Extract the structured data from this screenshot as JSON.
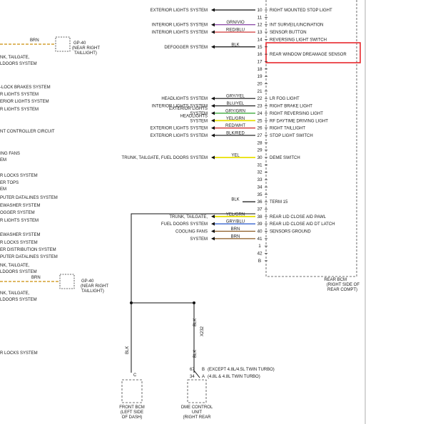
{
  "colors": {
    "highlight": "#e8262b",
    "wire_default": "#111111",
    "wire_orange": "#d4a030",
    "wire_yellow": "#e8e000",
    "wire_purple": "#7a2f9a",
    "wire_red": "#cc2222",
    "wire_blue": "#2255cc",
    "wire_green": "#2aa02a",
    "wire_brown": "#8a5a20"
  },
  "left_labels": [
    "NK, TAILGATE,",
    "LDOORS SYSTEM",
    "-LOCK BRAKES SYSTEM",
    "R LIGHTS SYSTEM",
    "ERIOR LIGHTS SYSTEM",
    "R LIGHTS SYSTEM",
    "NT CONTROLLER CIRCUIT",
    "ING FANS",
    "EM",
    "R LOCKS SYSTEM",
    "ER TOPS",
    "EM",
    "PUTER DATALINES SYSTEM",
    "EWASHER SYSTEM",
    "OGGER SYSTEM",
    "R LIGHTS SYSTEM",
    "EWASHER SYSTEM",
    "R LOCKS SYSTEM",
    "ER DISTRIBUTION SYSTEM",
    "PUTER DATALINES SYSTEM",
    "NK, TAILGATE,",
    "LDOORS SYSTEM",
    "NK, TAILGATE,",
    "LDOORS SYSTEM",
    "R LOCKS SYSTEM"
  ],
  "connectors": {
    "upper": {
      "wire": "BRN",
      "id": "GP-40",
      "loc1": "(NEAR RIGHT",
      "loc2": "TAILLIGHT)"
    },
    "lower": {
      "wire": "BRN",
      "id": "GP-40",
      "loc1": "(NEAR RIGHT",
      "loc2": "TAILLIGHT)"
    }
  },
  "pins": [
    {
      "num": "10",
      "system": [
        "EXTERIOR LIGHTS SYSTEM"
      ],
      "wire": "",
      "desc": "RIGHT MOUNTED STOP LIGHT"
    },
    {
      "num": "11",
      "system": [],
      "wire": "",
      "desc": ""
    },
    {
      "num": "12",
      "system": [
        "INTERIOR LIGHTS SYSTEM"
      ],
      "wire": "GRN/VIO",
      "desc": "INT SURVEIL/UNCINATION"
    },
    {
      "num": "13",
      "system": [
        "INTERIOR LIGHTS SYSTEM"
      ],
      "wire": "RED/BLU",
      "desc": "SENSOR BUTTON"
    },
    {
      "num": "14",
      "system": [],
      "wire": "",
      "desc": "REVERSING LIGHT SWITCH"
    },
    {
      "num": "15",
      "system": [
        "DEFOGGER SYSTEM"
      ],
      "wire": "BLK",
      "desc": ""
    },
    {
      "num": "16",
      "system": [],
      "wire": "",
      "desc": "REAR WINDOW DREAMAGE SENSOR"
    },
    {
      "num": "17",
      "system": [],
      "wire": "",
      "desc": ""
    },
    {
      "num": "18",
      "system": [],
      "wire": "",
      "desc": ""
    },
    {
      "num": "19",
      "system": [],
      "wire": "",
      "desc": ""
    },
    {
      "num": "20",
      "system": [],
      "wire": "",
      "desc": ""
    },
    {
      "num": "21",
      "system": [],
      "wire": "",
      "desc": ""
    },
    {
      "num": "22",
      "system": [
        "HEADLIGHTS SYSTEM"
      ],
      "wire": "GRY/YEL",
      "desc": "LR FOG LIGHT"
    },
    {
      "num": "23",
      "system": [
        "INTERIOR LIGHTS SYSTEM"
      ],
      "wire": "BLU/YEL",
      "desc": "RIGHT BRAKE LIGHT"
    },
    {
      "num": "24",
      "system": [
        "EXTERIOR LIGHTS",
        "SYSTEM"
      ],
      "wire": "GRY/GRN",
      "desc": "RIGHT REVERSING LIGHT"
    },
    {
      "num": "25",
      "system": [
        "HEADLIGHTS",
        "SYSTEM"
      ],
      "wire": "YEL/GRN",
      "desc": "RF DAYTIME DRIVING LIGHT"
    },
    {
      "num": "26",
      "system": [
        "EXTERIOR LIGHTS SYSTEM"
      ],
      "wire": "RED/WHT",
      "desc": "RIGHT TAILLIGHT"
    },
    {
      "num": "27",
      "system": [
        "EXTERIOR LIGHTS SYSTEM"
      ],
      "wire": "BLK/RED",
      "desc": "STOP LIGHT SWITCH"
    },
    {
      "num": "28",
      "system": [],
      "wire": "",
      "desc": ""
    },
    {
      "num": "29",
      "system": [],
      "wire": "",
      "desc": ""
    },
    {
      "num": "30",
      "system": [
        "TRUNK, TAILGATE, FUEL DOORS SYSTEM"
      ],
      "wire": "YEL",
      "desc": "DEME SWITCH"
    },
    {
      "num": "31",
      "system": [],
      "wire": "",
      "desc": ""
    },
    {
      "num": "32",
      "system": [],
      "wire": "",
      "desc": ""
    },
    {
      "num": "33",
      "system": [],
      "wire": "",
      "desc": ""
    },
    {
      "num": "34",
      "system": [],
      "wire": "",
      "desc": ""
    },
    {
      "num": "35",
      "system": [],
      "wire": "",
      "desc": ""
    },
    {
      "num": "36",
      "system": [],
      "wire": "BLK",
      "desc": "TERM 15"
    },
    {
      "num": "37",
      "system": [],
      "wire": "",
      "desc": ""
    },
    {
      "num": "38",
      "system": [
        "TRUNK, TAILGATE,"
      ],
      "wire": "YEL/GRN",
      "desc": "REAR LID CLOSE AID PAWL"
    },
    {
      "num": "39",
      "system": [
        "FUEL DOORS SYSTEM"
      ],
      "wire": "GRY/BLU",
      "desc": "REAR LID CLOSE AID DT LATCH"
    },
    {
      "num": "40",
      "system": [
        "COOLING FANS"
      ],
      "wire": "BRN",
      "desc": "SENSORS GROUND"
    },
    {
      "num": "41",
      "system": [
        "SYSTEM"
      ],
      "wire": "BRN",
      "desc": ""
    },
    {
      "num": "1",
      "system": [],
      "wire": "",
      "desc": ""
    },
    {
      "num": "42",
      "system": [],
      "wire": "",
      "desc": ""
    },
    {
      "num": "B",
      "system": [],
      "wire": "",
      "desc": ""
    }
  ],
  "module": {
    "name": "REAR BCM",
    "loc1": "(RIGHT SIDE OF",
    "loc2": "REAR COMPT)"
  },
  "bottom": {
    "wire_left": "BLK",
    "wire_right_upper": "BLK",
    "wire_right_lower": "BLK",
    "splice": "X232",
    "pin_left": "C",
    "pin_right_b": "B",
    "pin_right_a": "A",
    "pin_num_67": "67",
    "pin_num_34": "34",
    "note_b": "(EXCEPT 4.8L/4.5L TWIN TURBO)",
    "note_a": "(4.8L & 4.8L TWIN TURBO)",
    "front_name": "FRONT BCM",
    "front_loc1": "(LEFT SIDE",
    "front_loc2": "OF DASH)",
    "dme_name": "DME CONTROL",
    "dme_name2": "UNIT",
    "dme_loc": "(RIGHT REAR"
  }
}
